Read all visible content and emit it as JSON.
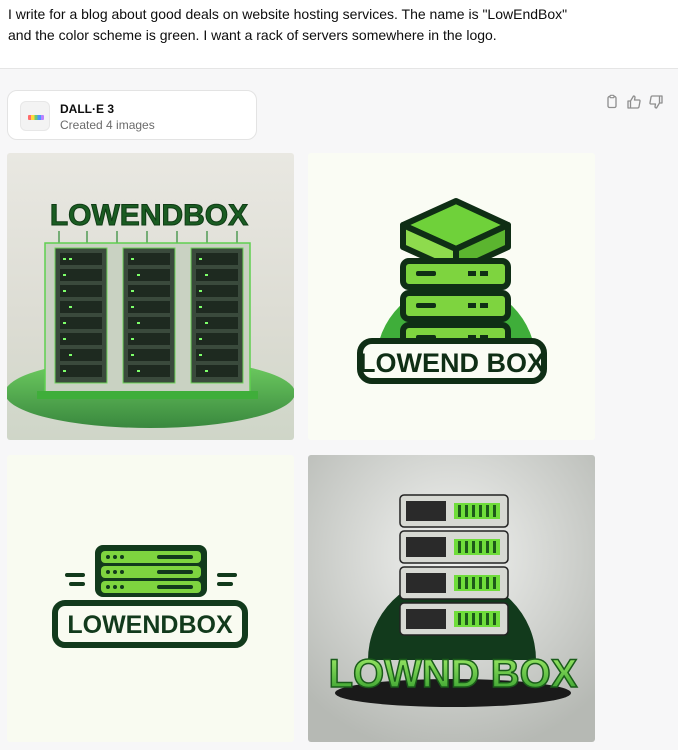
{
  "prompt": {
    "line1": "I write for a blog about good deals on website hosting services. The name is \"LowEndBox\"",
    "line2": "and the color scheme is green. I want a rack of servers somewhere in the logo."
  },
  "tool": {
    "name": "DALL·E 3",
    "status": "Created 4 images"
  },
  "actions": [
    "copy-icon",
    "thumbs-up-icon",
    "thumbs-down-icon"
  ],
  "images": [
    {
      "logo_text": "LOWENDBOX",
      "style": "server-cabinet-photo"
    },
    {
      "logo_text": "LOWEND BOX",
      "style": "stacked-server-badge"
    },
    {
      "logo_text": "LOWENDBOX",
      "style": "flat-minimal"
    },
    {
      "logo_text": "LOWND BOX",
      "style": "3d-render"
    }
  ],
  "colors": {
    "accent_green": "#5bc236",
    "dark_green": "#123a1c",
    "light_green": "#8edb4d"
  }
}
